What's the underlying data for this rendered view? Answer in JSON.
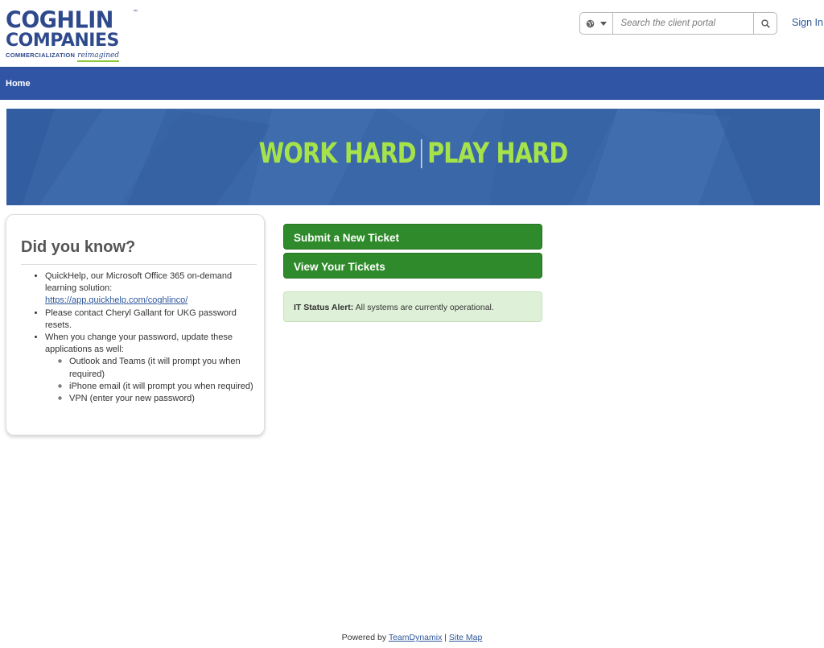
{
  "header": {
    "logo": {
      "line1": "COGHLIN",
      "line2": "COMPANIES",
      "tm": "™",
      "tagline_main": "COMMERCIALIZATION",
      "tagline_script": "reimagined"
    },
    "search": {
      "placeholder": "Search the client portal",
      "language_icon": "globe-icon",
      "submit_icon": "search-icon"
    },
    "signin_label": "Sign In"
  },
  "nav": {
    "items": [
      {
        "label": "Home"
      }
    ]
  },
  "banner": {
    "left": "WORK HARD",
    "right": "PLAY HARD"
  },
  "did_you_know": {
    "title": "Did you know?",
    "items": [
      {
        "text": "QuickHelp, our Microsoft Office 365 on-demand learning solution:",
        "link": "https://app.quickhelp.com/coghlinco/"
      },
      {
        "text": "Please contact Cheryl Gallant for UKG password resets."
      },
      {
        "text": "When you change your password, update these applications as well:",
        "subitems": [
          "Outlook and Teams (it will prompt you when required)",
          "iPhone email (it will prompt you when required)",
          "VPN (enter your new password)"
        ]
      }
    ]
  },
  "actions": {
    "submit_ticket": "Submit a New Ticket",
    "view_tickets": "View Your Tickets"
  },
  "alert": {
    "label": "IT Status Alert:",
    "message": "All systems are currently operational."
  },
  "footer": {
    "prefix": "Powered by",
    "link1": "TeamDynamix",
    "separator": "|",
    "link2": "Site Map"
  },
  "colors": {
    "brand_blue": "#2f4a8c",
    "nav_blue": "#3055a4",
    "button_green": "#2e8a2a",
    "banner_green": "#a6e34b",
    "alert_bg": "#dff0d8"
  }
}
